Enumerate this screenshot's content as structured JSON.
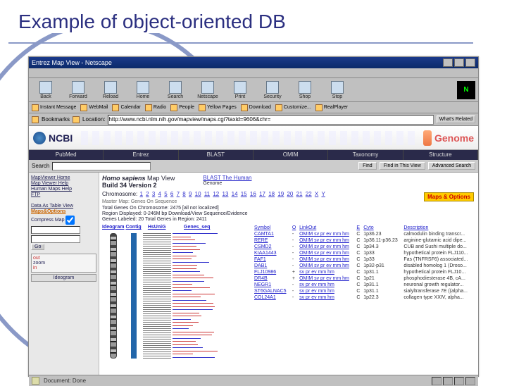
{
  "slide": {
    "title": "Example of object-oriented DB"
  },
  "window": {
    "title": "Entrez Map View - Netscape"
  },
  "toolbar": {
    "buttons": [
      "Back",
      "Forward",
      "Reload",
      "Home",
      "Search",
      "Netscape",
      "Print",
      "Security",
      "Shop",
      "Stop"
    ],
    "netscape_n": "N"
  },
  "toolbar2": {
    "items": [
      "Instant Message",
      "WebMail",
      "Calendar",
      "Radio",
      "People",
      "Yellow Pages",
      "Download",
      "Customize...",
      "RealPlayer"
    ]
  },
  "addressbar": {
    "bookmarks": "Bookmarks",
    "location_label": "Location:",
    "location_value": "http://www.ncbi.nlm.nih.gov/mapview/maps.cgi?taxid=9606&chr=",
    "related": "What's Related"
  },
  "ncbi": {
    "name": "NCBI",
    "genome": "Genome"
  },
  "tabs": [
    "PubMed",
    "Entrez",
    "BLAST",
    "OMIM",
    "Taxonomy",
    "Structure"
  ],
  "search": {
    "label": "Search",
    "placeholder": "",
    "find_btn": "Find",
    "find_view_btn": "Find in This View",
    "advanced_btn": "Advanced Search"
  },
  "sidebar": {
    "mvhome": "MapViewer Home",
    "help": "Map Viewer Help",
    "human_help": "Human Maps Help",
    "ftp": "FTP",
    "data_view": "Data As Table View",
    "maps_options": "Maps&Options",
    "compress": "Compress Map",
    "go": "Go",
    "out": "out",
    "zoom": "zoom",
    "in": "in",
    "ideogram": "Ideogram"
  },
  "main": {
    "species": "Homo sapiens",
    "mapview": "Map View",
    "build": "Build 34 Version 2",
    "blast_human": "BLAST The Human",
    "blast_sub": "Genome",
    "chrom_label": "Chromosome:",
    "chroms": [
      "1",
      "2",
      "3",
      "4",
      "5",
      "6",
      "7",
      "8",
      "9",
      "10",
      "11",
      "12",
      "13",
      "14",
      "15",
      "16",
      "17",
      "18",
      "19",
      "20",
      "21",
      "22",
      "X",
      "Y"
    ],
    "master": "Master Map: Genes On Sequence",
    "maps_options_btn": "Maps & Options",
    "stats1": "Total Genes On Chromosome: 2475   [all not localized]",
    "stats2": "Region Displayed: 0-246M bp Download/View Sequence/Evidence",
    "stats3": "Genes Labeled: 20 Total Genes in Region: 2411"
  },
  "tracks": {
    "headers": [
      "Ideogram",
      "Contig",
      "HsUniG",
      "Genes_seq"
    ]
  },
  "table": {
    "headers": [
      "Symbol",
      "O",
      "LinkOut",
      "E",
      "Cyto",
      "Description"
    ],
    "rows": [
      {
        "sym": "CAMTA1",
        "o": "-",
        "links": "OMIM sv pr ev mm hm",
        "e": "C",
        "cyto": "1p36.23",
        "desc": "calmodulin binding transcr..."
      },
      {
        "sym": "RERE",
        "o": "-",
        "links": "OMIM sv pr ev mm hm",
        "e": "C",
        "cyto": "1p36.11-p36.23",
        "desc": "arginine-glutamic acid dipe..."
      },
      {
        "sym": "CSMD2",
        "o": "-",
        "links": "OMIM sv pr ev mm hm",
        "e": "C",
        "cyto": "1p34.3",
        "desc": "CUB and Sushi multiple do..."
      },
      {
        "sym": "KIAA1443",
        "o": "-",
        "links": "OMIM sv pr ev mm hm",
        "e": "C",
        "cyto": "1p33",
        "desc": "hypothetical protein FLJ110..."
      },
      {
        "sym": "FAF1",
        "o": "-",
        "links": "OMIM sv pr ev mm hm",
        "e": "C",
        "cyto": "1p33",
        "desc": "Fas (TNFRSF6) associated..."
      },
      {
        "sym": "DAB1",
        "o": "-",
        "links": "OMIM sv pr ev mm hm",
        "e": "C",
        "cyto": "1p32-p31",
        "desc": "disabled homolog 1 (Droso..."
      },
      {
        "sym": "FLJ10986",
        "o": "+",
        "links": "sv pr ev mm hm",
        "e": "C",
        "cyto": "1p31.1",
        "desc": "hypothetical protein FLJ10..."
      },
      {
        "sym": "DR4B",
        "o": "+",
        "links": "OMIM sv pr ev mm hm",
        "e": "C",
        "cyto": "1p21",
        "desc": "phosphodiesterase 4B, cA..."
      },
      {
        "sym": "NEGR1",
        "o": "-",
        "links": "sv pr ev mm hm",
        "e": "C",
        "cyto": "1p31.1",
        "desc": "neuronal growth regulator..."
      },
      {
        "sym": "ST6GALNAC5",
        "o": "-",
        "links": "sv pr ev mm hm",
        "e": "C",
        "cyto": "1p31.1",
        "desc": "sialyltransferase 7E ((alpha..."
      },
      {
        "sym": "COL24A1",
        "o": "-",
        "links": "sv pr ev mm hm",
        "e": "C",
        "cyto": "1p22.3",
        "desc": "collagen type XXIV, alpha..."
      }
    ]
  },
  "statusbar": {
    "text": "Document: Done"
  }
}
